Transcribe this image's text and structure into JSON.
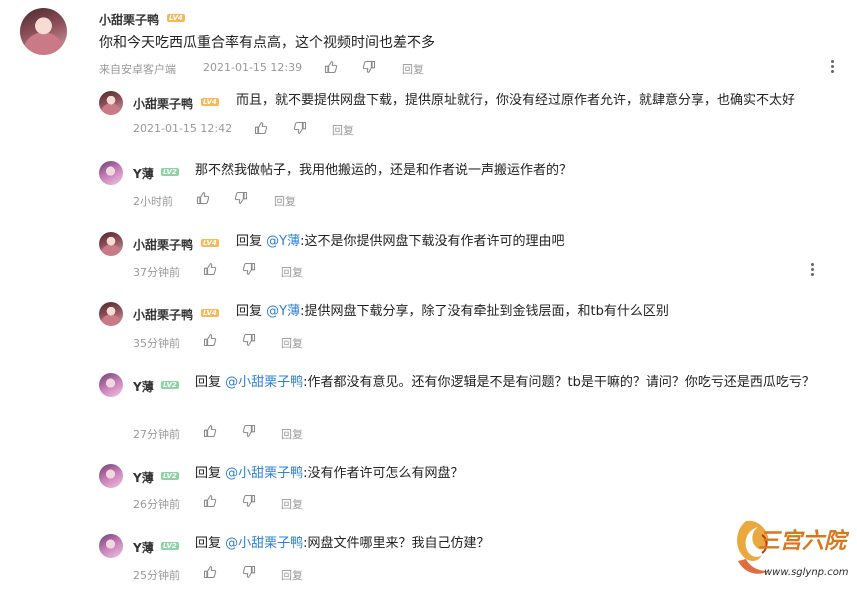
{
  "top": {
    "username": "小甜栗子鸭",
    "level": "LV4",
    "text": "你和今天吃西瓜重合率有点高，这个视频时间也差不多",
    "source": "来自安卓客户端",
    "time": "2021-01-15 12:39",
    "reply_label": "回复"
  },
  "replies": [
    {
      "username": "小甜栗子鸭",
      "level": "LV4",
      "prefix": "",
      "mention": "",
      "text": "而且，就不要提供网盘下载，提供原址就行，你没有经过原作者允许，就肆意分享，也确实不太好",
      "time": "2021-01-15 12:42",
      "reply_label": "回复"
    },
    {
      "username": "Y薄",
      "level": "LV2",
      "prefix": "",
      "mention": "",
      "text": "那不然我做帖子，我用他搬运的，还是和作者说一声搬运作者的？",
      "time": "2小时前",
      "reply_label": "回复"
    },
    {
      "username": "小甜栗子鸭",
      "level": "LV4",
      "prefix": "回复",
      "mention": "@Y薄",
      "text": ":这不是你提供网盘下载没有作者许可的理由吧",
      "time": "37分钟前",
      "reply_label": "回复"
    },
    {
      "username": "小甜栗子鸭",
      "level": "LV4",
      "prefix": "回复",
      "mention": "@Y薄",
      "text": ":提供网盘下载分享，除了没有牵扯到金钱层面，和tb有什么区别",
      "time": "35分钟前",
      "reply_label": "回复"
    },
    {
      "username": "Y薄",
      "level": "LV2",
      "prefix": "回复",
      "mention": "@小甜栗子鸭",
      "text": ":作者都没有意见。还有你逻辑是不是有问题？tb是干嘛的？请问？你吃亏还是西瓜吃亏？",
      "time": "27分钟前",
      "reply_label": "回复"
    },
    {
      "username": "Y薄",
      "level": "LV2",
      "prefix": "回复",
      "mention": "@小甜栗子鸭",
      "text": ":没有作者许可怎么有网盘？",
      "time": "26分钟前",
      "reply_label": "回复"
    },
    {
      "username": "Y薄",
      "level": "LV2",
      "prefix": "回复",
      "mention": "@小甜栗子鸭",
      "text": ":网盘文件哪里来？我自己仿建？",
      "time": "25分钟前",
      "reply_label": "回复"
    }
  ],
  "watermark": {
    "name": "三宫六院",
    "url": "www.sglynp.com"
  },
  "colors": {
    "mention": "#2d7fd8",
    "meta": "#999999",
    "lv4": "#f6b85a",
    "lv2": "#8fd3a4"
  },
  "icons": {
    "like": "thumbs-up-icon",
    "dislike": "thumbs-down-icon",
    "more": "more-vertical-icon"
  }
}
